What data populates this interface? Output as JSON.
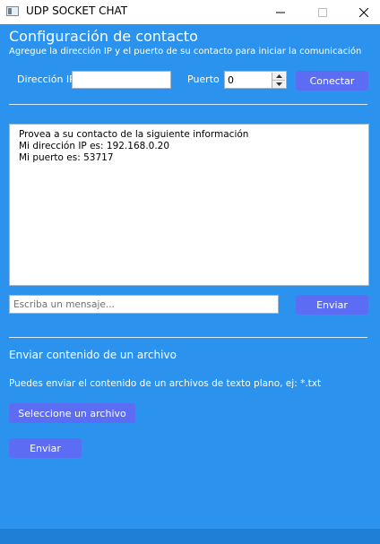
{
  "window": {
    "title": "UDP SOCKET CHAT",
    "controls": {
      "minimize": "—",
      "maximize": "☐",
      "close": "✕"
    }
  },
  "config": {
    "heading": "Configuración de contacto",
    "subtitle": "Agregue la dirección IP y el puerto de su contacto para iniciar la comunicación",
    "ip_label": "Dirección IP",
    "ip_value": "",
    "port_label": "Puerto",
    "port_value": "0",
    "connect_label": "Conectar"
  },
  "log": {
    "lines": [
      "Provea a su contacto de la siguiente información",
      "Mi dirección IP es: 192.168.0.20",
      "Mi puerto es: 53717"
    ]
  },
  "message": {
    "placeholder": "Escriba un mensaje...",
    "send_label": "Enviar"
  },
  "file": {
    "heading": "Enviar contenido de un archivo",
    "description": "Puedes enviar el contenido de un archivos de texto plano, ej: *.txt",
    "select_label": "Seleccione un archivo",
    "send_label": "Enviar"
  },
  "colors": {
    "background": "#2b93ee",
    "button": "#5d6df3",
    "text": "#ffffff"
  }
}
